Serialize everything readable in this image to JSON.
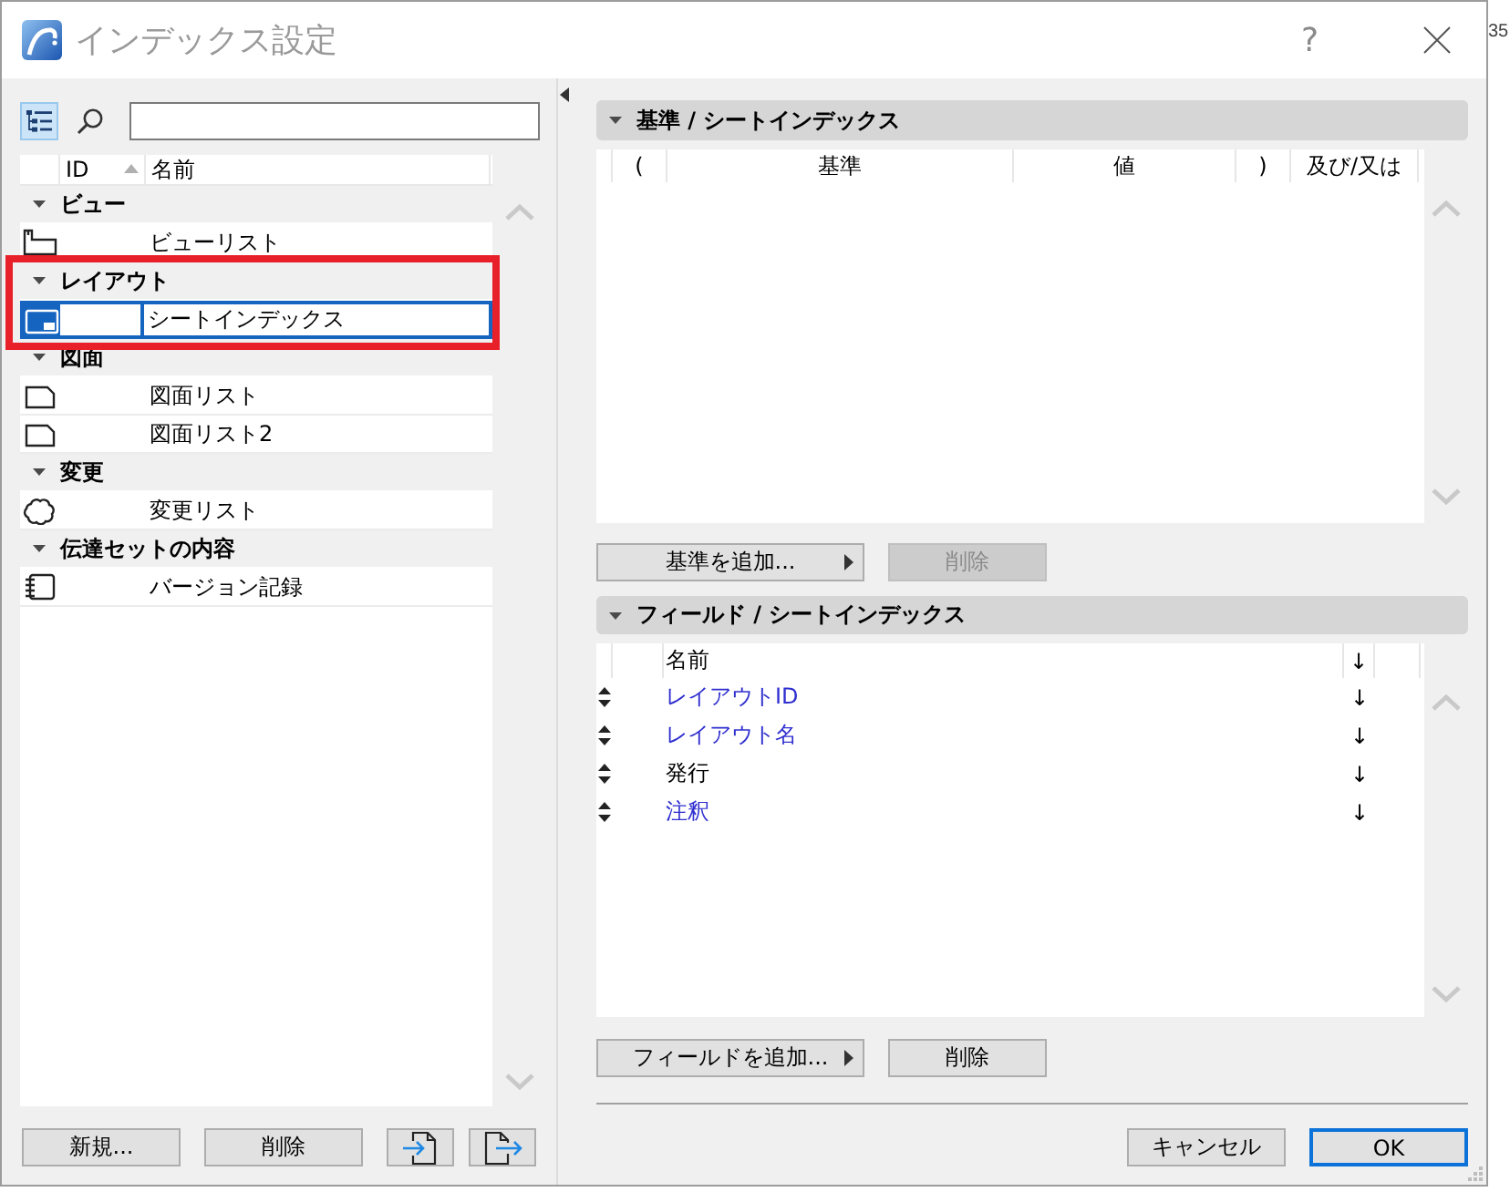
{
  "window": {
    "title": "インデックス設定",
    "help": "?"
  },
  "background_window": {
    "text": "35"
  },
  "index_list": {
    "view_button": {
      "selected": true
    },
    "columns": [
      "ID",
      "名前"
    ],
    "groups": [
      {
        "label": "ビュー",
        "expanded": true,
        "highlighted": false,
        "items": [
          {
            "kind": "view",
            "name": "ビューリスト",
            "selected": false
          }
        ]
      },
      {
        "label": "レイアウト",
        "expanded": true,
        "highlighted": true,
        "items": [
          {
            "kind": "layout",
            "name": "シートインデックス",
            "selected": true
          }
        ]
      },
      {
        "label": "図面",
        "expanded": true,
        "highlighted": false,
        "items": [
          {
            "kind": "drawing",
            "name": "図面リスト",
            "selected": false
          },
          {
            "kind": "drawing",
            "name": "図面リスト2",
            "selected": false
          }
        ]
      },
      {
        "label": "変更",
        "expanded": true,
        "highlighted": false,
        "items": [
          {
            "kind": "change",
            "name": "変更リスト",
            "selected": false
          }
        ]
      },
      {
        "label": "伝達セットの内容",
        "expanded": true,
        "highlighted": false,
        "items": [
          {
            "kind": "transmittal",
            "name": "バージョン記録",
            "selected": false
          }
        ]
      }
    ],
    "buttons": [
      {
        "kind": "text",
        "label": "新規..."
      },
      {
        "kind": "text",
        "label": "削除"
      },
      {
        "kind": "import"
      },
      {
        "kind": "export"
      }
    ]
  },
  "criteria": {
    "title": "基準 / シートインデックス",
    "expanded": true,
    "columns": [
      "(",
      "基準",
      "値",
      ")",
      "及び/又は"
    ],
    "buttons": [
      {
        "label": "基準を追加...",
        "menu": true,
        "disabled": false
      },
      {
        "label": "削除",
        "menu": false,
        "disabled": true
      }
    ]
  },
  "fields": {
    "title": "フィールド / シートインデックス",
    "expanded": true,
    "columns": [
      "名前",
      "↓"
    ],
    "rows": [
      {
        "name": "レイアウトID",
        "color": "#2f2fd0",
        "order": "↓"
      },
      {
        "name": "レイアウト名",
        "color": "#2f2fd0",
        "order": "↓"
      },
      {
        "name": "発行",
        "color": "#000000",
        "order": "↓"
      },
      {
        "name": "注釈",
        "color": "#2f2fd0",
        "order": "↓"
      }
    ],
    "buttons": [
      {
        "label": "フィールドを追加...",
        "menu": true,
        "disabled": false
      },
      {
        "label": "削除",
        "menu": false,
        "disabled": false
      }
    ]
  },
  "dialog_buttons": [
    {
      "label": "キャンセル",
      "default": false
    },
    {
      "label": "OK",
      "default": true
    }
  ]
}
